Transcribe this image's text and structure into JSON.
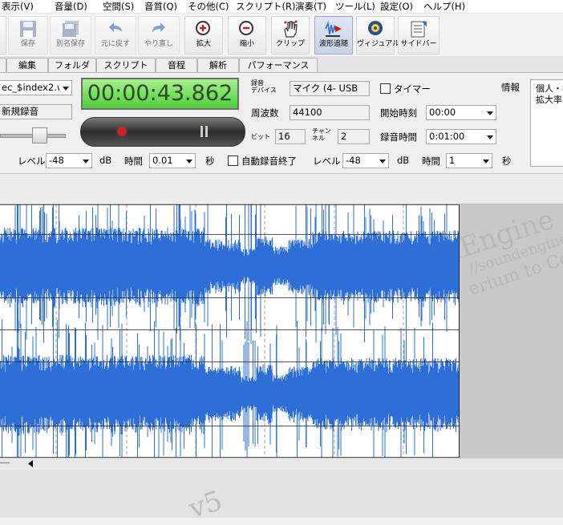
{
  "menu": [
    "表示(V)",
    "音量(D)",
    "空間(S)",
    "音質(Q)",
    "その他(C)",
    "スクリプト(R)",
    "演奏(T)",
    "ツール(L)",
    "設定(O)",
    "ヘルプ(H)"
  ],
  "toolbar": {
    "save": "保存",
    "save_as": "別名保存",
    "undo": "元に戻す",
    "redo": "やり直し",
    "zoom_in": "拡大",
    "zoom_out": "縮小",
    "clip": "クリップ",
    "wave_follow": "波形追随",
    "visual": "ヴィジュアル",
    "sidebar": "サイドバー"
  },
  "tabs": [
    "編集",
    "フォルダ",
    "スクリプト",
    "音程",
    "解析",
    "パフォーマンス"
  ],
  "recorder": {
    "file_select": "ec_$index2.w",
    "new_recording": "新規録音",
    "time": "00:00:43.862",
    "device_label_1": "録音",
    "device_label_2": "デバイス",
    "device_value": "マイク (4- USB",
    "freq_label": "周波数",
    "freq_value": "44100",
    "bit_label": "ビット",
    "bit_value": "16",
    "channel_label_1": "チャン",
    "channel_label_2": "ネル",
    "channel_value": "2",
    "timer_label": "タイマー",
    "start_label": "開始時刻",
    "start_value": "00:00",
    "rec_time_label": "録音時間",
    "rec_time_value": "0:01:00",
    "info_label": "情報",
    "info_line1": "個人・教",
    "info_line2": "拡大率"
  },
  "level_row": {
    "level_label": "レベル",
    "level_value": "-48",
    "db": "dB",
    "time_label": "時間",
    "time_value": "0.01",
    "sec": "秒",
    "auto_stop_label": "自動録音終了",
    "level2_label": "レベル",
    "level2_value": "-48",
    "db2": "dB",
    "time2_label": "時間",
    "time2_value": "1",
    "sec2": "秒"
  },
  "watermark": {
    "brand": "dEngine",
    "url": "//soundengine.",
    "tagline": "erium to Cod",
    "version": "v5"
  },
  "colors": {
    "waveform": "#2d6fd6",
    "timer_bg": "#6fd94f",
    "record": "#e01b1b"
  }
}
